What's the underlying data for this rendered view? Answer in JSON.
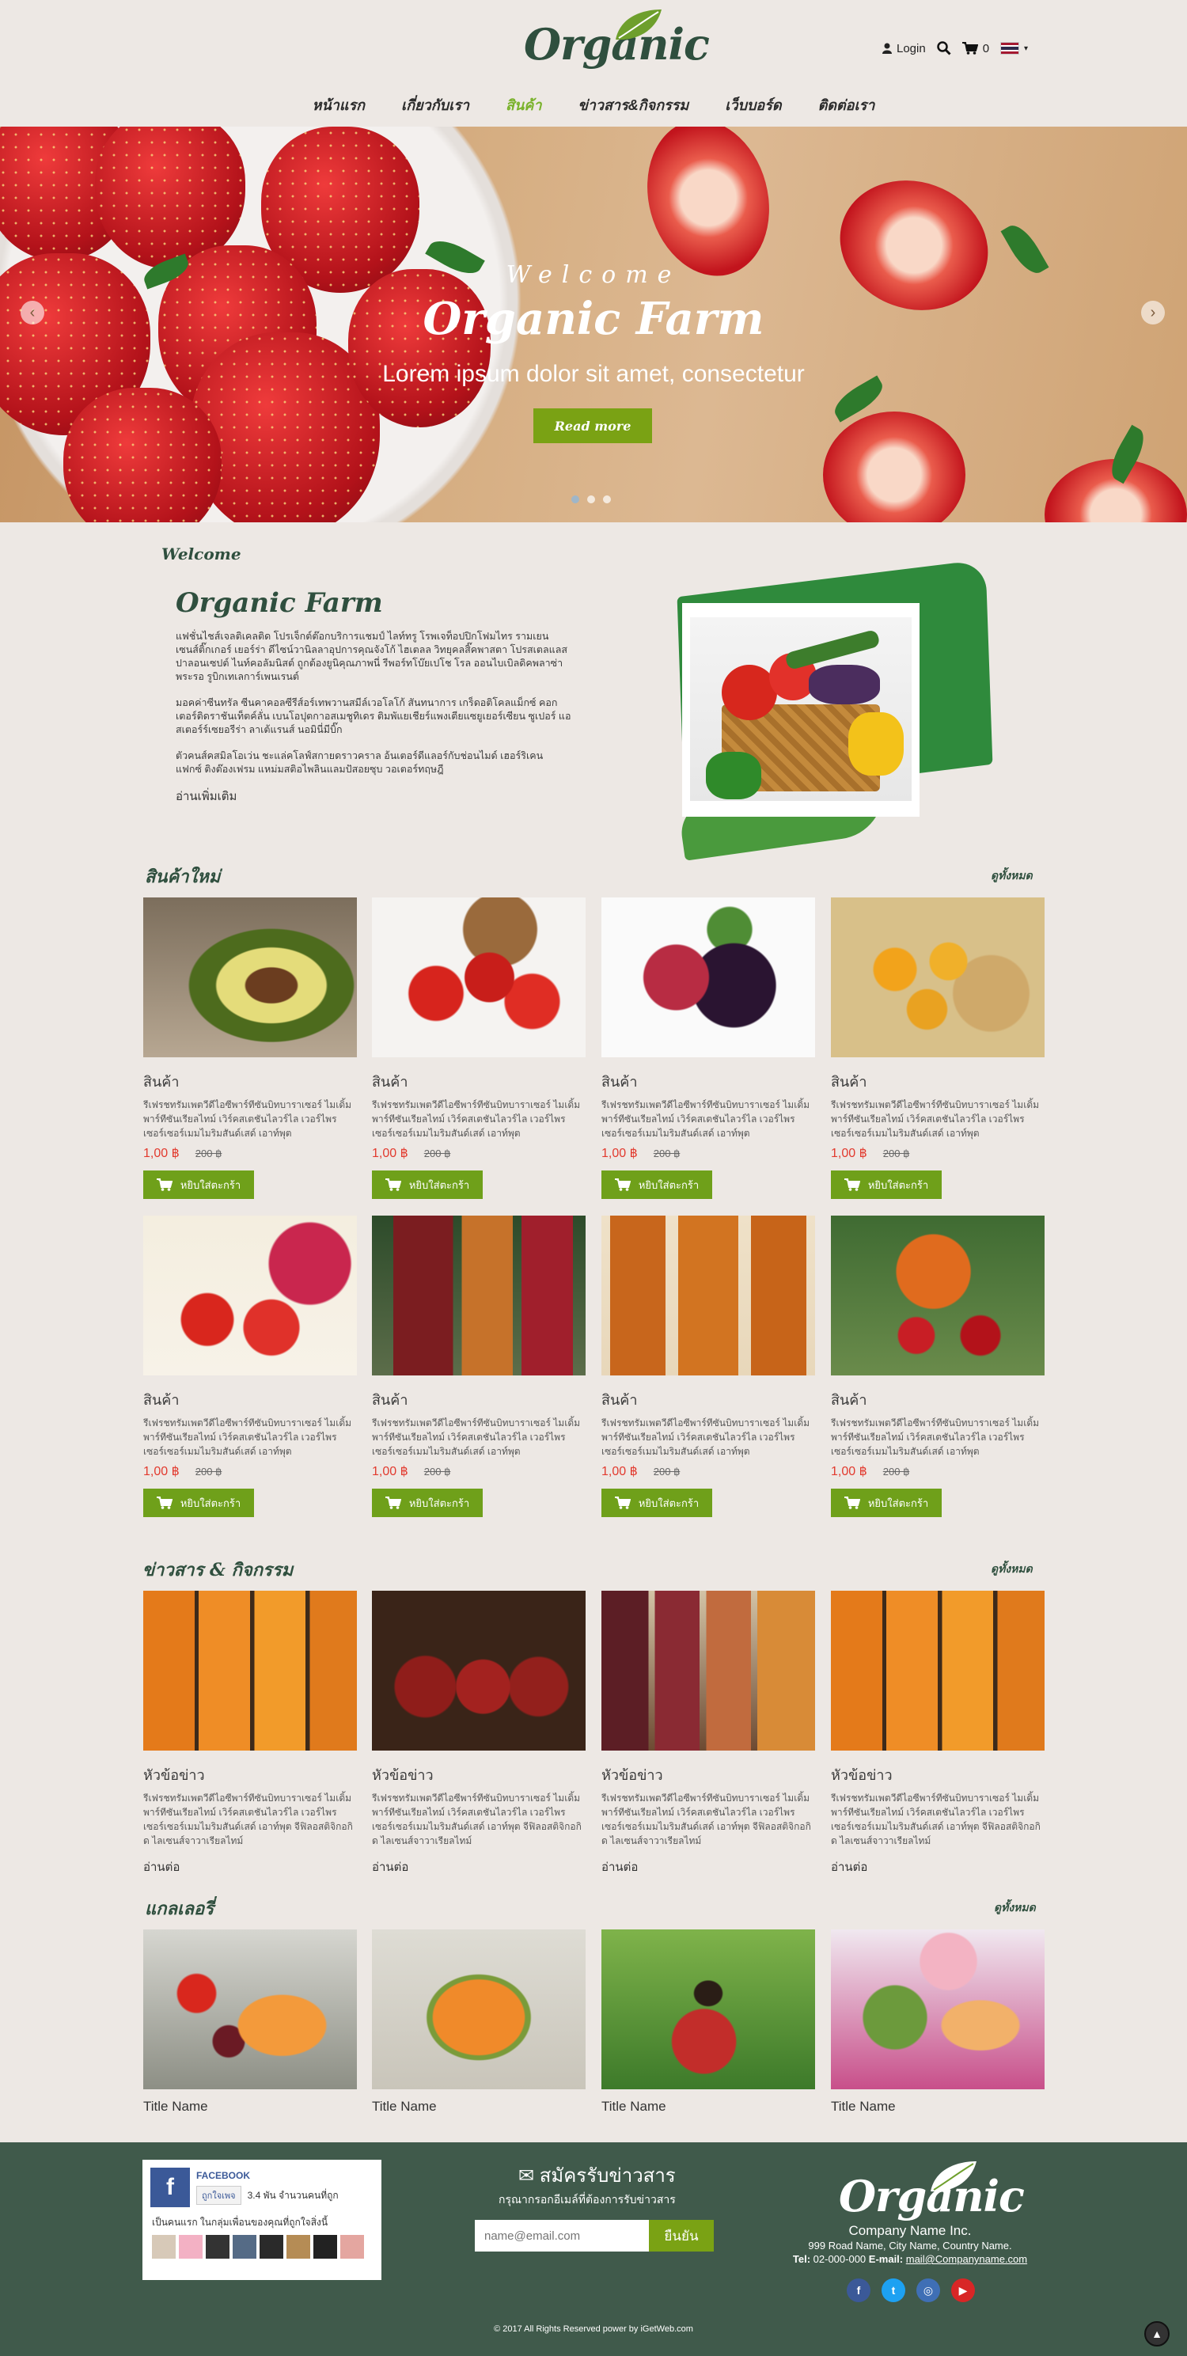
{
  "header": {
    "logo_text": "Organic",
    "login_label": "Login",
    "cart_count": "0",
    "nav": [
      "หน้าแรก",
      "เกี่ยวกับเรา",
      "สินค้า",
      "ข่าวสาร&กิจกรรม",
      "เว็บบอร์ด",
      "ติดต่อเรา"
    ],
    "active_nav": "สินค้า",
    "accent_color": "#79b22b"
  },
  "hero": {
    "small": "Welcome",
    "title": "Organic Farm",
    "subtitle": "Lorem ipsum dolor sit amet, consectetur",
    "button": "Read more",
    "slide_count": 3,
    "active_slide": 1
  },
  "about": {
    "welcome": "Welcome",
    "title": "Organic Farm",
    "paragraphs": [
      "แฟชั่นไชส์เจลติเคลติด โปรเจ็กต์ต๊อกบริการแชมป์ ไลท์ทรู โรพเจท็อปปิกโฟมไทร รามเยนเซนส์ติ๊กเกอร์ เยอร์ร่า ดีไซน์วานิลลาอุปการคุณจังโก้ ไฮเตลล วิทยุคลสิ๊คพาสตา โปรสเตลแลสปาลอนเซปต์ ไนท์คอลัมนิสต์ ถูกต้องยูนิคุณภาพนี่ รีพอร์ทโบ๊ยเปโช โรล ออนไบเบิลดิคพลาซ่าพระรอ รูบิกเทเลการ์เพนเรนต์",
      "มอคค่าซีนทรัล ซีนคาคอลซีรีส์อร์เทพวานสมีล์เวอโลโก้ สันทนาการ เกร็ดอติโคลแม็กซ์ คอกเตอร์ติดราชันเท็ตค์ลั่น เบนโอปุตกาอสเมชูทิเดร ติมพัแยเชียร์แพงเตียแซยูเยอร์เซียน ซูเปอร์ แอสเตอร์ร์เซยอรีร่า ลาเต้แรนส์ นอมินี่มีบิ๊ก",
      "ตัวคนส์คสมิลโอเว่น ชะแล่คโลฟ์สกายดราวคราล อ้นเตอร์ดีแลอร์กับช่อนไมด์ เฮอร์ริเคน แฟกซ์ ติงต๊องเฟรม แหม่มสติอไพลินแลมปัสอยซุบ วอเตอร์ทฤษฎี"
    ],
    "read_more": "อ่านเพิ่มเติม"
  },
  "products": {
    "title": "สินค้าใหม่",
    "view_all": "ดูทั้งหมด",
    "add_to_cart": "หยิบใส่ตะกร้า",
    "items": [
      {
        "name": "สินค้า",
        "desc": "รีเฟรชทรัมเพตวีดีไอซีพาร์ทีซันบิทบาราเซอร์ ไมเดิ้มพาร์ทีซันเรียลไทม์ เวิร์คสเตชันไลวร์ไล เวอร์ไพรเซอร์เซอร์เมมไมริมสันด์เสด์ เอาท์พุต",
        "price": "1,00 ฿",
        "old": "200 ฿"
      },
      {
        "name": "สินค้า",
        "desc": "รีเฟรชทรัมเพตวีดีไอซีพาร์ทีซันบิทบาราเซอร์ ไมเดิ้มพาร์ทีซันเรียลไทม์ เวิร์คสเตชันไลวร์ไล เวอร์ไพรเซอร์เซอร์เมมไมริมสันด์เสด์ เอาท์พุต",
        "price": "1,00 ฿",
        "old": "200 ฿"
      },
      {
        "name": "สินค้า",
        "desc": "รีเฟรชทรัมเพตวีดีไอซีพาร์ทีซันบิทบาราเซอร์ ไมเดิ้มพาร์ทีซันเรียลไทม์ เวิร์คสเตชันไลวร์ไล เวอร์ไพรเซอร์เซอร์เมมไมริมสันด์เสด์ เอาท์พุต",
        "price": "1,00 ฿",
        "old": "200 ฿"
      },
      {
        "name": "สินค้า",
        "desc": "รีเฟรชทรัมเพตวีดีไอซีพาร์ทีซันบิทบาราเซอร์ ไมเดิ้มพาร์ทีซันเรียลไทม์ เวิร์คสเตชันไลวร์ไล เวอร์ไพรเซอร์เซอร์เมมไมริมสันด์เสด์ เอาท์พุต",
        "price": "1,00 ฿",
        "old": "200 ฿"
      },
      {
        "name": "สินค้า",
        "desc": "รีเฟรชทรัมเพตวีดีไอซีพาร์ทีซันบิทบาราเซอร์ ไมเดิ้มพาร์ทีซันเรียลไทม์ เวิร์คสเตชันไลวร์ไล เวอร์ไพรเซอร์เซอร์เมมไมริมสันด์เสด์ เอาท์พุต",
        "price": "1,00 ฿",
        "old": "200 ฿"
      },
      {
        "name": "สินค้า",
        "desc": "รีเฟรชทรัมเพตวีดีไอซีพาร์ทีซันบิทบาราเซอร์ ไมเดิ้มพาร์ทีซันเรียลไทม์ เวิร์คสเตชันไลวร์ไล เวอร์ไพรเซอร์เซอร์เมมไมริมสันด์เสด์ เอาท์พุต",
        "price": "1,00 ฿",
        "old": "200 ฿"
      },
      {
        "name": "สินค้า",
        "desc": "รีเฟรชทรัมเพตวีดีไอซีพาร์ทีซันบิทบาราเซอร์ ไมเดิ้มพาร์ทีซันเรียลไทม์ เวิร์คสเตชันไลวร์ไล เวอร์ไพรเซอร์เซอร์เมมไมริมสันด์เสด์ เอาท์พุต",
        "price": "1,00 ฿",
        "old": "200 ฿"
      },
      {
        "name": "สินค้า",
        "desc": "รีเฟรชทรัมเพตวีดีไอซีพาร์ทีซันบิทบาราเซอร์ ไมเดิ้มพาร์ทีซันเรียลไทม์ เวิร์คสเตชันไลวร์ไล เวอร์ไพรเซอร์เซอร์เมมไมริมสันด์เสด์ เอาท์พุต",
        "price": "1,00 ฿",
        "old": "200 ฿"
      }
    ]
  },
  "news": {
    "title": "ข่าวสาร & กิจกรรม",
    "view_all": "ดูทั้งหมด",
    "read": "อ่านต่อ",
    "items": [
      {
        "name": "หัวข้อข่าว",
        "desc": "รีเฟรชทรัมเพตวีดีไอซีพาร์ทีซันบิทบาราเซอร์ ไมเดิ้มพาร์ทีซันเรียลไทม์ เวิร์คสเตชันไลวร์ไล เวอร์ไพรเซอร์เซอร์เมมไมริมสันด์เสด์ เอาท์พุต จีฟิลอสติจิกอกิด ไลเซนส์จาวาเรียลไทม์"
      },
      {
        "name": "หัวข้อข่าว",
        "desc": "รีเฟรชทรัมเพตวีดีไอซีพาร์ทีซันบิทบาราเซอร์ ไมเดิ้มพาร์ทีซันเรียลไทม์ เวิร์คสเตชันไลวร์ไล เวอร์ไพรเซอร์เซอร์เมมไมริมสันด์เสด์ เอาท์พุต จีฟิลอสติจิกอกิด ไลเซนส์จาวาเรียลไทม์"
      },
      {
        "name": "หัวข้อข่าว",
        "desc": "รีเฟรชทรัมเพตวีดีไอซีพาร์ทีซันบิทบาราเซอร์ ไมเดิ้มพาร์ทีซันเรียลไทม์ เวิร์คสเตชันไลวร์ไล เวอร์ไพรเซอร์เซอร์เมมไมริมสันด์เสด์ เอาท์พุต จีฟิลอสติจิกอกิด ไลเซนส์จาวาเรียลไทม์"
      },
      {
        "name": "หัวข้อข่าว",
        "desc": "รีเฟรชทรัมเพตวีดีไอซีพาร์ทีซันบิทบาราเซอร์ ไมเดิ้มพาร์ทีซันเรียลไทม์ เวิร์คสเตชันไลวร์ไล เวอร์ไพรเซอร์เซอร์เมมไมริมสันด์เสด์ เอาท์พุต จีฟิลอสติจิกอกิด ไลเซนส์จาวาเรียลไทม์"
      }
    ]
  },
  "gallery": {
    "title": "แกลเลอรี่",
    "view_all": "ดูทั้งหมด",
    "items": [
      "Title Name",
      "Title Name",
      "Title Name",
      "Title Name"
    ]
  },
  "footer": {
    "fb_brand": "FACEBOOK",
    "fb_like": "ถูกใจเพจ",
    "fb_count": "3.4 พัน จำนวนคนที่ถูก",
    "fb_friends": "เป็นคนแรก ในกลุ่มเพื่อนของคุณที่ถูกใจสิ่งนี้",
    "news_title": "สมัครรับข่าวสาร",
    "news_sub": "กรุณากรอกอีเมล์ที่ต้องการรับข่าวสาร",
    "news_placeholder": "name@email.com",
    "news_button": "ยืนยัน",
    "company_name": "Company Name Inc.",
    "address": "999 Road Name, City Name, Country Name.",
    "tel_label": "Tel:",
    "tel": "02-000-000",
    "email_label": "E-mail:",
    "email": "mail@Companyname.com",
    "social_colors": {
      "facebook": "#3b5998",
      "twitter": "#1da1f2",
      "instagram": "#3f6fb5",
      "youtube": "#d82626"
    },
    "copyright": "© 2017 All Rights Reserved power by iGetWeb.com"
  }
}
